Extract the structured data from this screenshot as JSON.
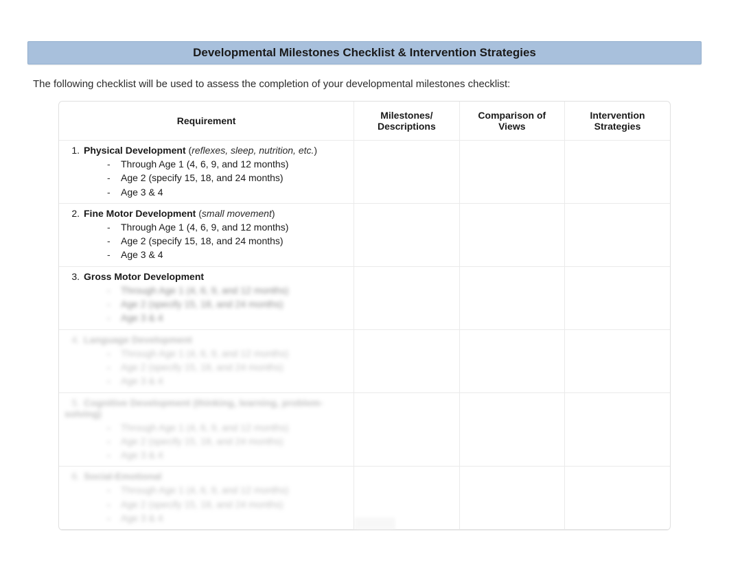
{
  "title": "Developmental Milestones Checklist & Intervention Strategies",
  "intro": "The following checklist will be used to assess the completion of your developmental milestones checklist:",
  "headers": {
    "requirement": "Requirement",
    "milestones": "Milestones/ Descriptions",
    "comparison": "Comparison of Views",
    "intervention": "Intervention Strategies"
  },
  "rows": [
    {
      "num": "1.",
      "title": "Physical Development",
      "note_pre": " (",
      "note": "reflexes, sleep, nutrition, etc.",
      "note_post": ")",
      "subs": [
        "Through Age 1 (4, 6, 9, and 12 months)",
        "Age 2 (specify 15, 18, and 24 months)",
        "Age 3 & 4"
      ],
      "blurred": false
    },
    {
      "num": "2.",
      "title": "Fine Motor Development",
      "note_pre": " (",
      "note": "small movement",
      "note_post": ")",
      "subs": [
        "Through Age 1 (4, 6, 9, and 12 months)",
        "Age 2 (specify 15, 18, and 24 months)",
        "Age 3 & 4"
      ],
      "blurred": false
    },
    {
      "num": "3.",
      "title": "Gross Motor Development",
      "note_pre": "",
      "note": "",
      "note_post": "",
      "subs": [
        "Through Age 1 (4, 6, 9, and 12 months)",
        "Age 2 (specify 15, 18, and 24 months)",
        "Age 3 & 4"
      ],
      "blurred": true,
      "title_visible": true
    },
    {
      "num": "4.",
      "title": "Language Development",
      "note_pre": "",
      "note": "",
      "note_post": "",
      "subs": [
        "Through Age 1 (4, 6, 9, and 12 months)",
        "Age 2 (specify 15, 18, and 24 months)",
        "Age 3 & 4"
      ],
      "blurred": true
    },
    {
      "num": "5.",
      "title": "Cognitive Development (thinking, learning, problem-solving)",
      "note_pre": "",
      "note": "",
      "note_post": "",
      "subs": [
        "Through Age 1 (4, 6, 9, and 12 months)",
        "Age 2 (specify 15, 18, and 24 months)",
        "Age 3 & 4"
      ],
      "blurred": true
    },
    {
      "num": "6.",
      "title": "Social-Emotional",
      "note_pre": "",
      "note": "",
      "note_post": "",
      "subs": [
        "Through Age 1 (4, 6, 9, and 12 months)",
        "Age 2 (specify 15, 18, and 24 months)",
        "Age 3 & 4"
      ],
      "blurred": true
    }
  ]
}
